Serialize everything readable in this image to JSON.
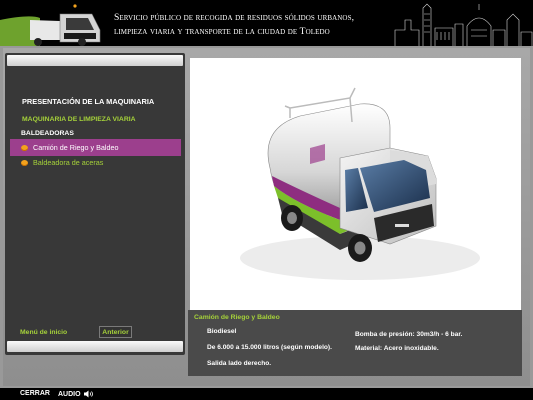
{
  "header": {
    "line1": "Servicio público de recogida de residuos sólidos urbanos,",
    "line2": "limpieza viaria y transporte de la ciudad de Toledo"
  },
  "sidebar": {
    "title": "PRESENTACIÓN DE LA MAQUINARIA",
    "section": "MAQUINARIA DE LIMPIEZA VIARIA",
    "subsection": "BALDEADORAS",
    "items": [
      {
        "label": "Camión de Riego y Baldeo",
        "active": true
      },
      {
        "label": "Baldeadora de aceras",
        "active": false
      }
    ],
    "menu_label": "Menú de inicio",
    "back_label": "Anterior"
  },
  "info": {
    "title": "Camión de Riego y Baldeo",
    "col1": [
      "Biodiesel",
      "De 6.000 a 15.000 litros (según modelo).",
      "Salida lado derecho."
    ],
    "col2": [
      "Bomba de presión: 30m3/h - 6 bar.",
      "Material: Acero inoxidable."
    ]
  },
  "footer": {
    "close_label": "CERRAR",
    "audio_label": "AUDIO"
  },
  "colors": {
    "accent_green": "#a5d13a",
    "active_purple": "#9c3f8d",
    "bullet_orange": "#f3a21d"
  },
  "icons": [
    "speaker-icon",
    "bullet-icon"
  ]
}
